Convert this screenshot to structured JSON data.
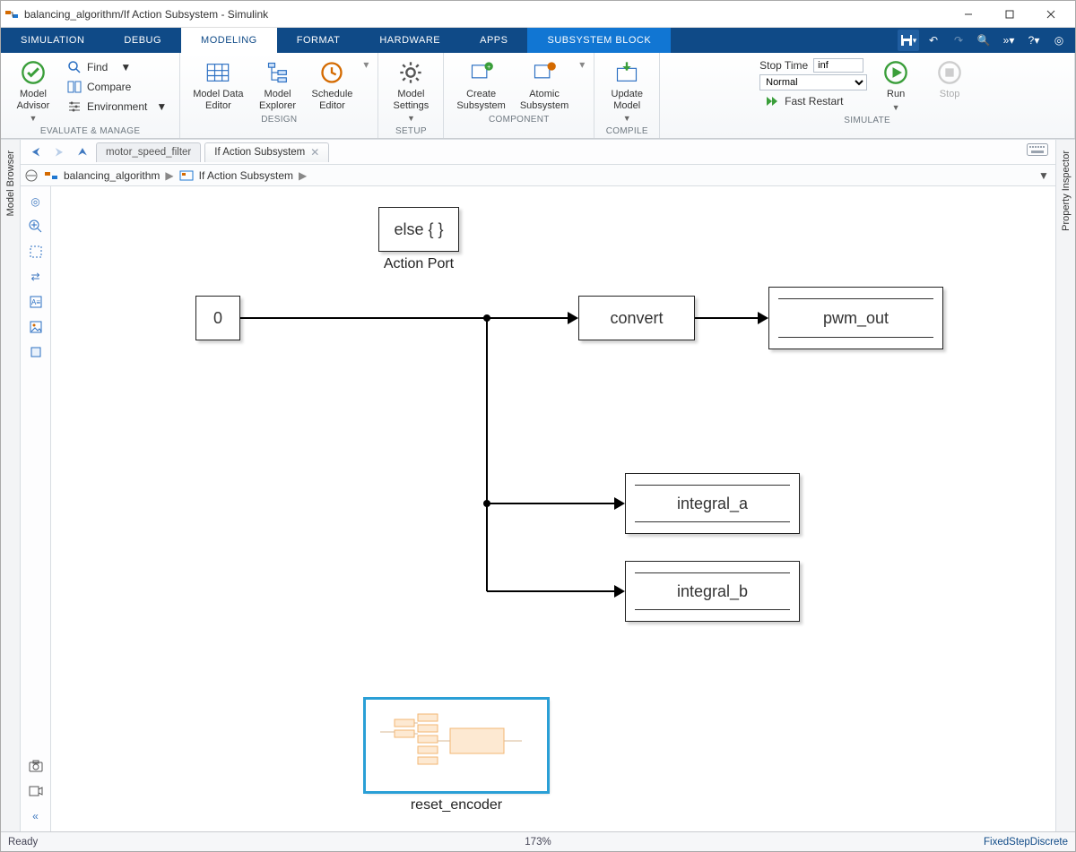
{
  "window": {
    "title": "balancing_algorithm/If Action Subsystem - Simulink"
  },
  "ribbon": {
    "tabs": [
      "SIMULATION",
      "DEBUG",
      "MODELING",
      "FORMAT",
      "HARDWARE",
      "APPS",
      "SUBSYSTEM BLOCK"
    ],
    "activeTab": "MODELING",
    "groups": {
      "evaluate": {
        "label": "EVALUATE & MANAGE",
        "modelAdvisor": "Model\nAdvisor",
        "find": "Find",
        "compare": "Compare",
        "environment": "Environment"
      },
      "design": {
        "label": "DESIGN",
        "modelDataEditor": "Model Data\nEditor",
        "modelExplorer": "Model\nExplorer",
        "scheduleEditor": "Schedule\nEditor"
      },
      "setup": {
        "label": "SETUP",
        "modelSettings": "Model\nSettings"
      },
      "component": {
        "label": "COMPONENT",
        "create": "Create\nSubsystem",
        "atomic": "Atomic\nSubsystem"
      },
      "compile": {
        "label": "COMPILE",
        "update": "Update\nModel"
      },
      "simulate": {
        "label": "SIMULATE",
        "stopTimeLabel": "Stop Time",
        "stopTimeValue": "inf",
        "mode": "Normal",
        "fastRestart": "Fast Restart",
        "run": "Run",
        "stop": "Stop"
      }
    }
  },
  "nav": {
    "tabs": [
      {
        "label": "motor_speed_filter",
        "active": false
      },
      {
        "label": "If Action Subsystem",
        "active": true
      }
    ],
    "crumbs": [
      "balancing_algorithm",
      "If Action Subsystem"
    ]
  },
  "leftPalette": "Model Browser",
  "rightPalette": "Property Inspector",
  "canvas": {
    "actionPort": {
      "text": "else { }",
      "label": "Action Port"
    },
    "constant": {
      "text": "0"
    },
    "convert": {
      "text": "convert"
    },
    "pwm_out": {
      "text": "pwm_out"
    },
    "integral_a": {
      "text": "integral_a"
    },
    "integral_b": {
      "text": "integral_b"
    },
    "reset_encoder": {
      "label": "reset_encoder"
    }
  },
  "status": {
    "ready": "Ready",
    "zoom": "173%",
    "solver": "FixedStepDiscrete"
  }
}
